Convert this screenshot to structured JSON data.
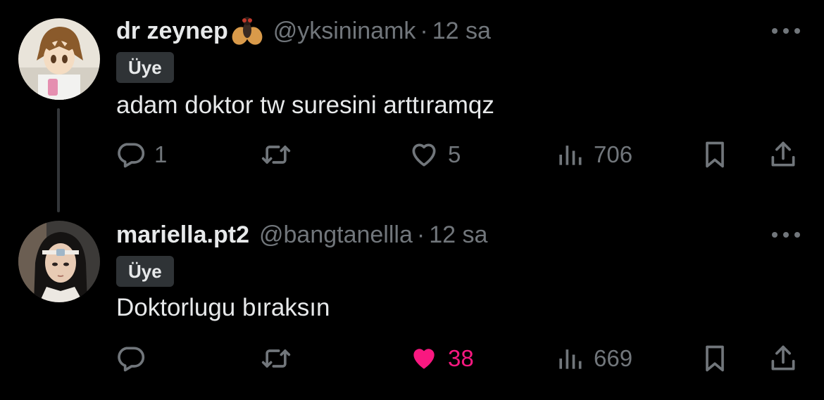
{
  "tweets": [
    {
      "display_name": "dr zeynep",
      "name_emoji": "fly-emoji",
      "handle": "@yksininamk",
      "separator": "·",
      "time": "12 sa",
      "badge": "Üye",
      "text": "adam doktor tw suresini arttıramqz",
      "replies": "1",
      "retweets": "",
      "likes": "5",
      "liked": false,
      "views": "706"
    },
    {
      "display_name": "mariella.pt2",
      "handle": "@bangtanellla",
      "separator": "·",
      "time": "12 sa",
      "badge": "Üye",
      "text": "Doktorlugu bıraksın",
      "replies": "",
      "retweets": "",
      "likes": "38",
      "liked": true,
      "views": "669"
    }
  ],
  "colors": {
    "background": "#000000",
    "text_primary": "#e7e9ea",
    "text_secondary": "#71767b",
    "like_active": "#f91880",
    "badge_bg": "#2f3336"
  },
  "icons": [
    "more-icon",
    "reply-icon",
    "retweet-icon",
    "heart-icon",
    "views-icon",
    "bookmark-icon",
    "share-icon"
  ]
}
